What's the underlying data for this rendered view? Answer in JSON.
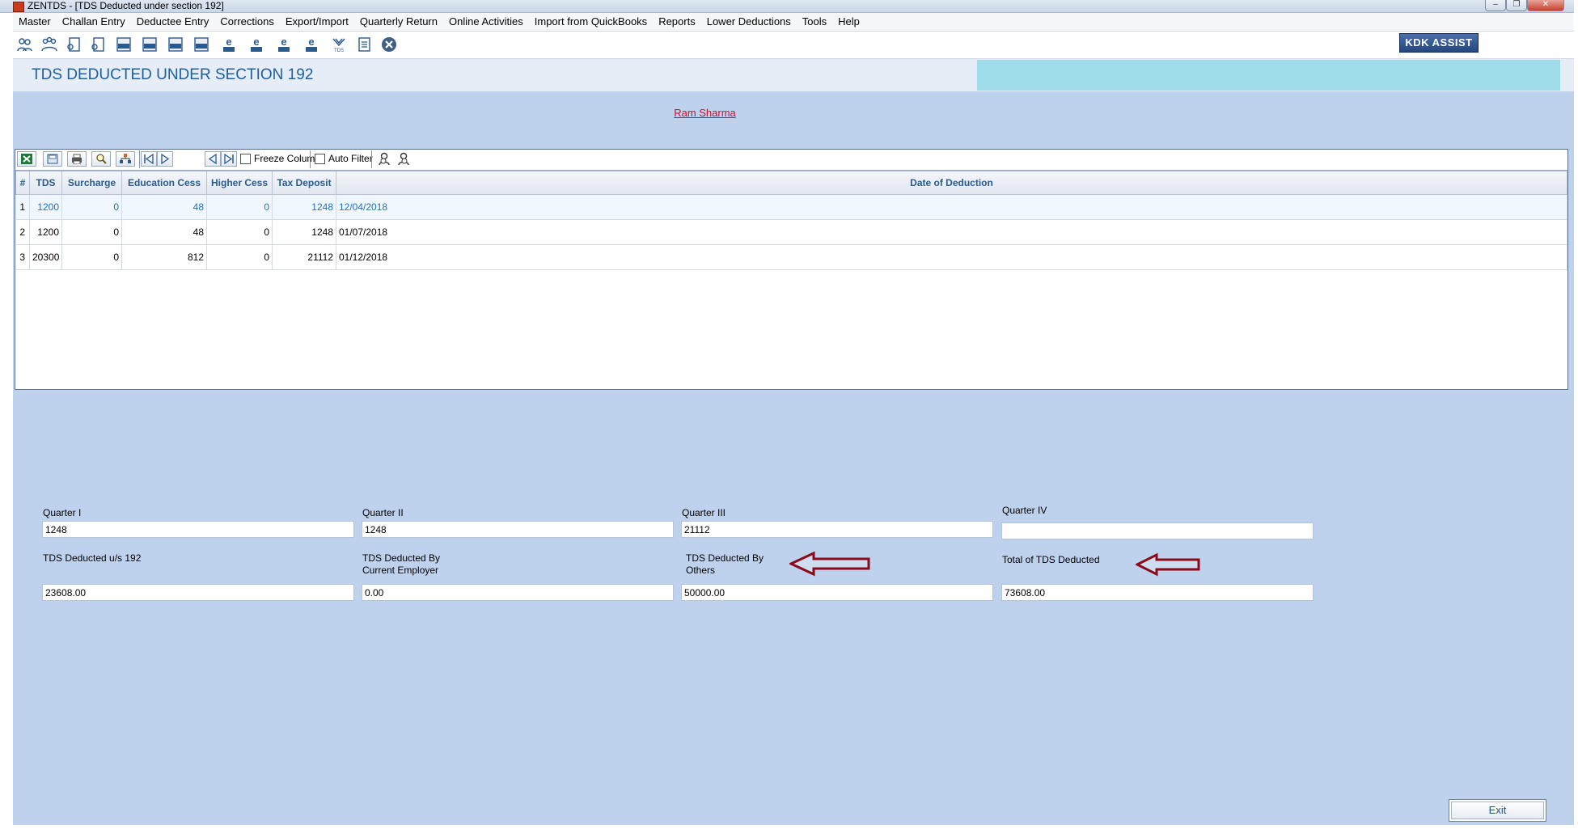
{
  "window": {
    "title": "ZENTDS - [TDS Deducted under section 192]",
    "controls": [
      "–",
      "❐",
      "✕"
    ]
  },
  "menu": [
    "Master",
    "Challan Entry",
    "Deductee Entry",
    "Corrections",
    "Export/Import",
    "Quarterly Return",
    "Online Activities",
    "Import from QuickBooks",
    "Reports",
    "Lower Deductions",
    "Tools",
    "Help"
  ],
  "toolbar": {
    "icons": [
      "persons-icon",
      "group-icon",
      "form-icon",
      "form2-icon",
      "24q-icon",
      "26q-icon",
      "27q-icon",
      "27eq-icon",
      "e24-icon",
      "e26-icon",
      "e27-icon",
      "e27eq-icon",
      "tds-icon",
      "report-icon",
      "close-circle-icon"
    ],
    "icon_labels": [
      "",
      "",
      "",
      "",
      "24Q",
      "26Q",
      "27Q",
      "27EQ",
      "24Q",
      "26Q",
      "27Q",
      "27EQ",
      "TDS",
      "",
      ""
    ],
    "kdk_assist": "KDK ASSIST"
  },
  "header": {
    "title": "TDS DEDUCTED UNDER SECTION 192"
  },
  "person_name": "Ram Sharma",
  "grid": {
    "freeze_label": "Freeze Column",
    "filter_label": "Auto Filter",
    "columns": [
      "#",
      "TDS",
      "Surcharge",
      "Education Cess",
      "Higher Cess",
      "Tax Deposit",
      "Date of Deduction"
    ],
    "rows": [
      [
        "1",
        "1200",
        "0",
        "48",
        "0",
        "1248",
        "12/04/2018"
      ],
      [
        "2",
        "1200",
        "0",
        "48",
        "0",
        "1248",
        "01/07/2018"
      ],
      [
        "3",
        "20300",
        "0",
        "812",
        "0",
        "21112",
        "01/12/2018"
      ]
    ]
  },
  "quarters": {
    "q1_label": "Quarter I",
    "q1_value": "1248",
    "q2_label": "Quarter II",
    "q2_value": "1248",
    "q3_label": "Quarter III",
    "q3_value": "21112",
    "q4_label": "Quarter IV",
    "q4_value": ""
  },
  "totals": {
    "tds192_label": "TDS Deducted u/s 192",
    "tds192_value": "23608.00",
    "current_label_1": "TDS Deducted By",
    "current_label_2": "Current Employer",
    "current_value": "0.00",
    "others_label_1": "TDS Deducted By",
    "others_label_2": "Others",
    "others_value": "50000.00",
    "total_label": "Total of TDS Deducted",
    "total_value": "73608.00"
  },
  "exit_label": "Exit",
  "colors": {
    "background": "#bfd2ed",
    "header_title": "#1e5fa0",
    "person_link": "#c8102e",
    "arrow": "#8b0a1a"
  }
}
